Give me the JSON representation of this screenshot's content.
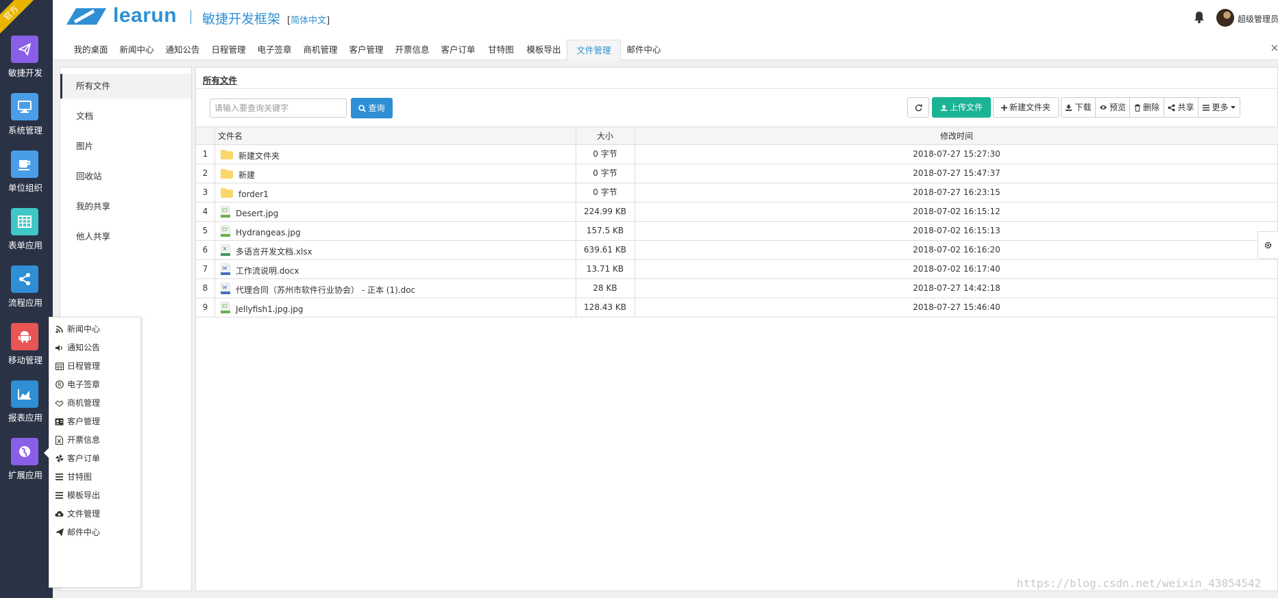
{
  "ribbon": "官方",
  "sidebar": {
    "items": [
      {
        "label": "敏捷开发",
        "icon": "paper-plane-icon",
        "color": "#8a5fe8"
      },
      {
        "label": "系统管理",
        "icon": "desktop-icon",
        "color": "#4a9ee8"
      },
      {
        "label": "单位组织",
        "icon": "coffee-icon",
        "color": "#4a9ee8"
      },
      {
        "label": "表单应用",
        "icon": "table-icon",
        "color": "#3fc6c6"
      },
      {
        "label": "流程应用",
        "icon": "share-icon",
        "color": "#2f8fd4"
      },
      {
        "label": "移动管理",
        "icon": "android-icon",
        "color": "#e85555"
      },
      {
        "label": "报表应用",
        "icon": "area-chart-icon",
        "color": "#2f8fd4"
      },
      {
        "label": "扩展应用",
        "icon": "globe-icon",
        "color": "#8a5fe8"
      }
    ]
  },
  "header": {
    "logo_text": "learun",
    "subtitle": "敏捷开发框架",
    "lang_open": "[",
    "lang": "简体中文",
    "lang_close": "]",
    "user": "超级管理员"
  },
  "tabs": [
    "我的桌面",
    "新闻中心",
    "通知公告",
    "日程管理",
    "电子签章",
    "商机管理",
    "客户管理",
    "开票信息",
    "客户订单",
    "甘特图",
    "模板导出",
    "文件管理",
    "邮件中心"
  ],
  "active_tab": "文件管理",
  "left_panel": {
    "items": [
      "所有文件",
      "文档",
      "图片",
      "回收站",
      "我的共享",
      "他人共享"
    ],
    "active": "所有文件"
  },
  "content": {
    "title": "所有文件",
    "search_placeholder": "请输入要查询关键字",
    "search_button": "查询",
    "toolbar": {
      "upload": "上传文件",
      "new_folder": "新建文件夹",
      "download": "下载",
      "preview": "预览",
      "delete": "删除",
      "share": "共享",
      "more": "更多"
    },
    "columns": {
      "name": "文件名",
      "size": "大小",
      "time": "修改时间"
    },
    "rows": [
      {
        "no": "1",
        "name": "新建文件夹",
        "type": "folder",
        "size": "0 字节",
        "time": "2018-07-27 15:27:30"
      },
      {
        "no": "2",
        "name": "新建",
        "type": "folder",
        "size": "0 字节",
        "time": "2018-07-27 15:47:37"
      },
      {
        "no": "3",
        "name": "forder1",
        "type": "folder",
        "size": "0 字节",
        "time": "2018-07-27 16:23:15"
      },
      {
        "no": "4",
        "name": "Desert.jpg",
        "type": "image",
        "size": "224.99 KB",
        "time": "2018-07-02 16:15:12"
      },
      {
        "no": "5",
        "name": "Hydrangeas.jpg",
        "type": "image",
        "size": "157.5 KB",
        "time": "2018-07-02 16:15:13"
      },
      {
        "no": "6",
        "name": "多语言开发文档.xlsx",
        "type": "excel",
        "size": "639.61 KB",
        "time": "2018-07-02 16:16:20"
      },
      {
        "no": "7",
        "name": "工作流说明.docx",
        "type": "word",
        "size": "13.71 KB",
        "time": "2018-07-02 16:17:40"
      },
      {
        "no": "8",
        "name": "代理合同（苏州市软件行业协会） - 正本 (1).doc",
        "type": "word",
        "size": "28 KB",
        "time": "2018-07-27 14:42:18"
      },
      {
        "no": "9",
        "name": "Jellyfish1.jpg.jpg",
        "type": "image",
        "size": "128.43 KB",
        "time": "2018-07-27 15:46:40"
      }
    ]
  },
  "popup_menu": {
    "items": [
      {
        "label": "新闻中心",
        "icon": "rss-icon"
      },
      {
        "label": "通知公告",
        "icon": "volume-icon"
      },
      {
        "label": "日程管理",
        "icon": "calendar-icon"
      },
      {
        "label": "电子签章",
        "icon": "registered-icon"
      },
      {
        "label": "商机管理",
        "icon": "handshake-icon"
      },
      {
        "label": "客户管理",
        "icon": "id-card-icon"
      },
      {
        "label": "开票信息",
        "icon": "file-excel-icon"
      },
      {
        "label": "客户订单",
        "icon": "pinwheel-icon"
      },
      {
        "label": "甘特图",
        "icon": "bars-icon"
      },
      {
        "label": "模板导出",
        "icon": "bars-icon"
      },
      {
        "label": "文件管理",
        "icon": "cloud-icon"
      },
      {
        "label": "邮件中心",
        "icon": "paper-plane-icon"
      }
    ]
  },
  "watermark": "https://blog.csdn.net/weixin_43054542"
}
